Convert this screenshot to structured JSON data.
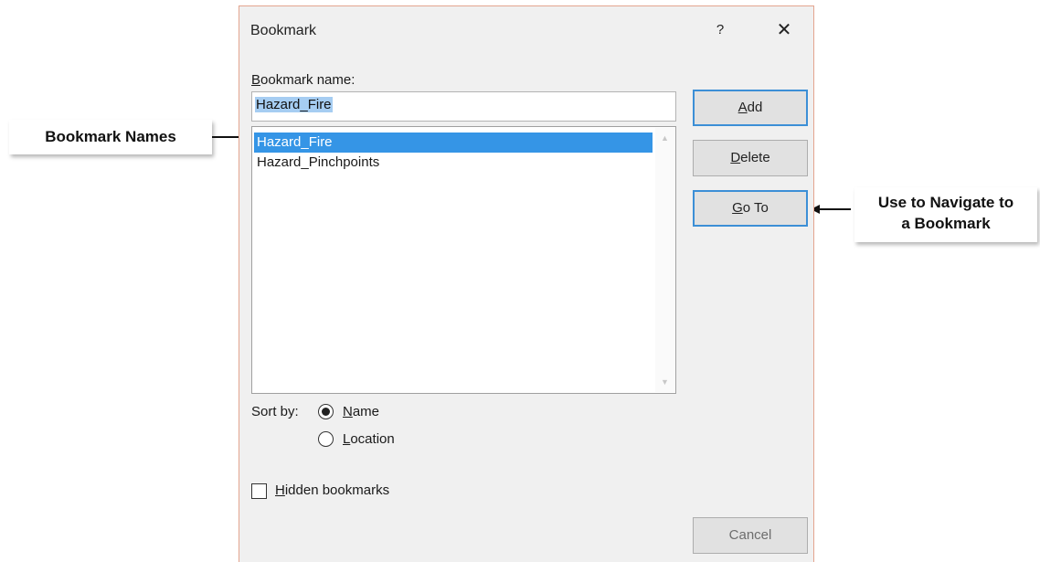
{
  "dialog": {
    "title": "Bookmark",
    "help": "?",
    "close": "✕"
  },
  "bookmark_name": {
    "label_accel": "B",
    "label_rest": "ookmark name:",
    "value": "Hazard_Fire"
  },
  "list": {
    "items": [
      {
        "label": "Hazard_Fire",
        "selected": true
      },
      {
        "label": "Hazard_Pinchpoints",
        "selected": false
      }
    ]
  },
  "buttons": {
    "add": {
      "accel": "A",
      "rest": "dd"
    },
    "delete": {
      "accel": "D",
      "rest": "elete"
    },
    "goto": {
      "accel": "G",
      "rest": "o To"
    },
    "cancel": "Cancel"
  },
  "sort": {
    "label": "Sort by:",
    "name": {
      "accel": "N",
      "rest": "ame",
      "checked": true
    },
    "location": {
      "accel": "L",
      "rest": "ocation",
      "checked": false
    }
  },
  "hidden": {
    "accel": "H",
    "rest": "idden bookmarks",
    "checked": false
  },
  "callouts": {
    "left": "Bookmark Names",
    "right_line1": "Use to Navigate to",
    "right_line2": "a Bookmark"
  },
  "icons": {
    "help": "question-icon",
    "close": "close-icon",
    "scroll_up": "chevron-up-icon",
    "scroll_down": "chevron-down-icon"
  }
}
